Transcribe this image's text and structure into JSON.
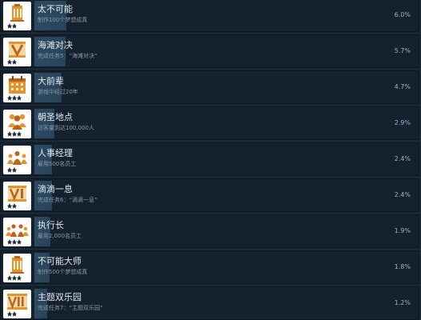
{
  "achievements": [
    {
      "title": "太不可能",
      "description": "制作100个梦想成真",
      "percent": 6.0,
      "percent_label": "6.0%",
      "icon": "monument-icon",
      "stars": 2
    },
    {
      "title": "海滩对决",
      "description": "完成任务5：“海滩对决”",
      "percent": 5.7,
      "percent_label": "5.7%",
      "icon": "roman-numeral-v-icon",
      "stars": 2
    },
    {
      "title": "大前辈",
      "description": "游戏中经过20年",
      "percent": 4.7,
      "percent_label": "4.7%",
      "icon": "calendar-icon",
      "stars": 3
    },
    {
      "title": "朝圣地点",
      "description": "访客量到达100,000人",
      "percent": 2.9,
      "percent_label": "2.9%",
      "icon": "crowd-icon",
      "stars": 3
    },
    {
      "title": "人事经理",
      "description": "雇用500名员工",
      "percent": 2.4,
      "percent_label": "2.4%",
      "icon": "staff-group-icon",
      "stars": 2
    },
    {
      "title": "滴滴一息",
      "description": "完成任务6：“滴滴一息”",
      "percent": 2.4,
      "percent_label": "2.4%",
      "icon": "roman-numeral-vi-icon",
      "stars": 2
    },
    {
      "title": "执行长",
      "description": "雇用2,000名员工",
      "percent": 1.9,
      "percent_label": "1.9%",
      "icon": "staff-crowd-icon",
      "stars": 3
    },
    {
      "title": "不可能大师",
      "description": "制作500个梦想成真",
      "percent": 1.8,
      "percent_label": "1.8%",
      "icon": "monument-icon",
      "stars": 3
    },
    {
      "title": "主题双乐园",
      "description": "完成任务7：“主题双乐园”",
      "percent": 1.2,
      "percent_label": "1.2%",
      "icon": "roman-numeral-vii-icon",
      "stars": 2
    }
  ]
}
